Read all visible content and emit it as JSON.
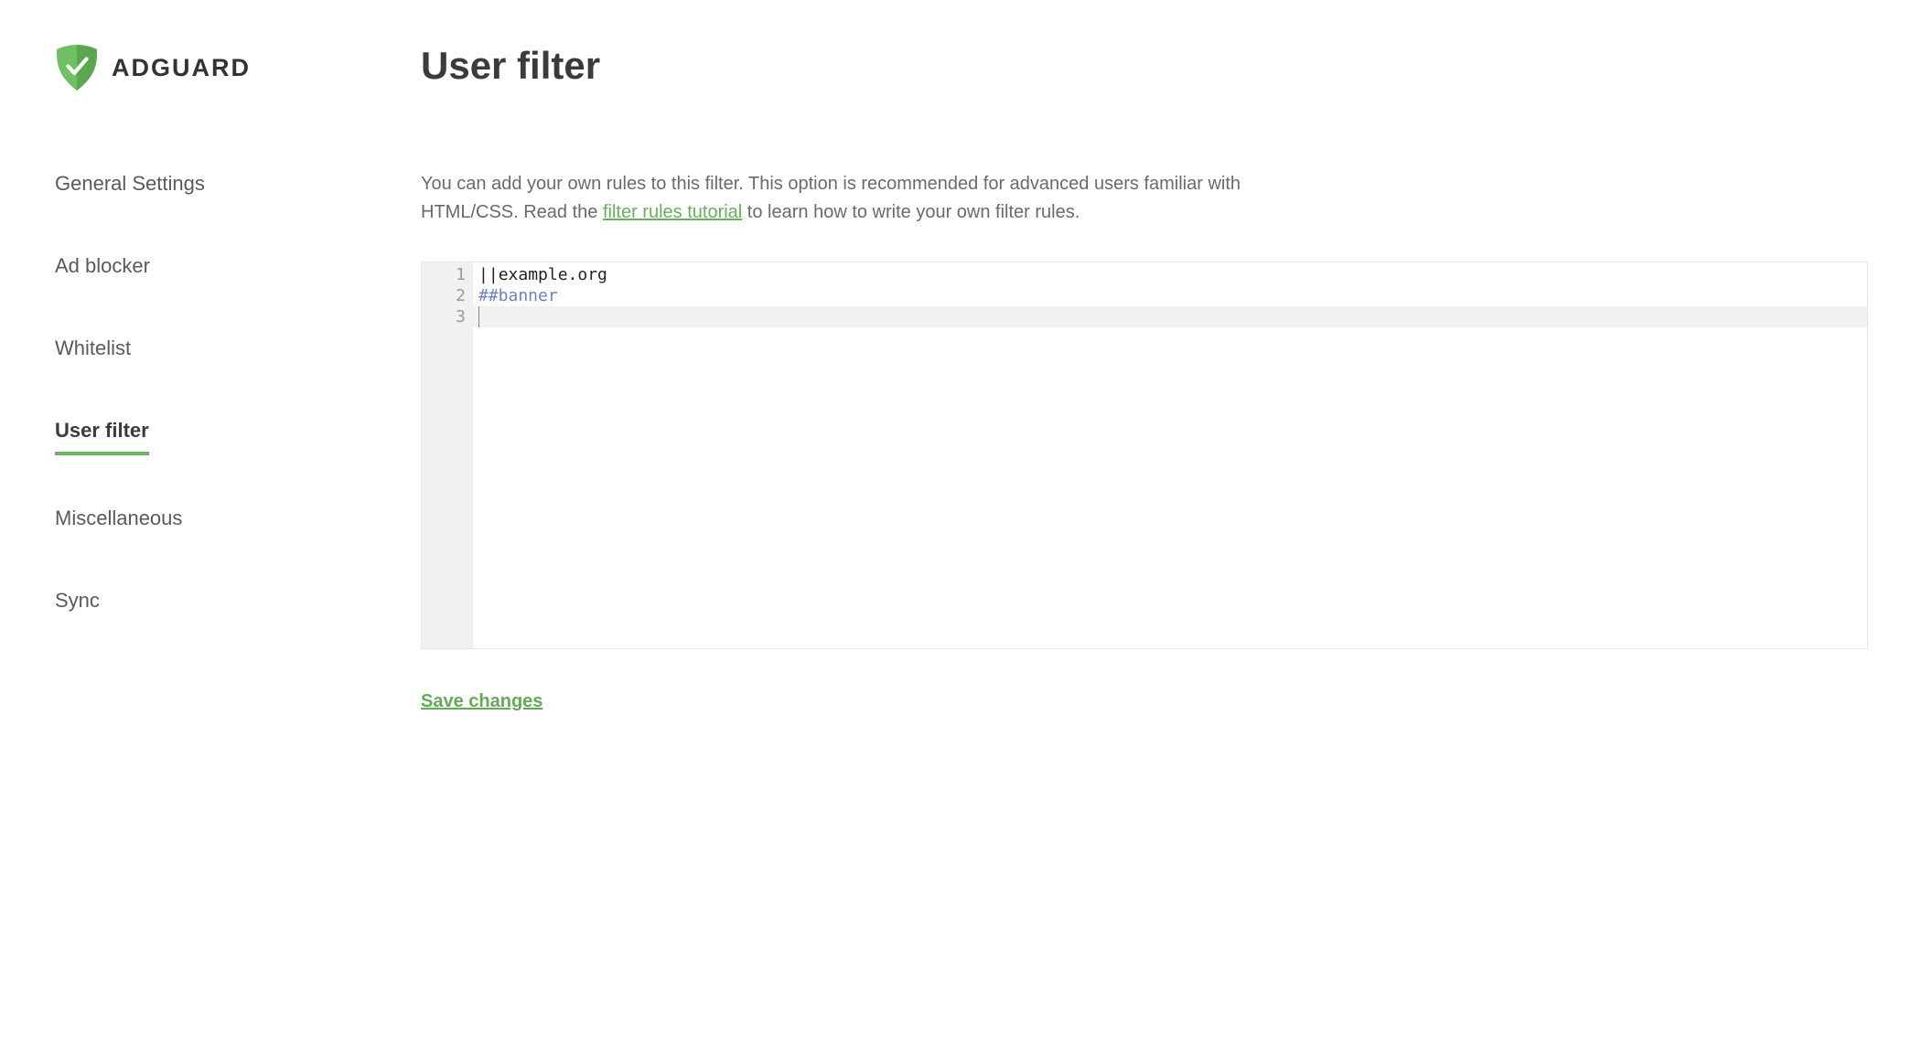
{
  "logo": {
    "text": "ADGUARD"
  },
  "sidebar": {
    "items": [
      {
        "label": "General Settings",
        "active": false
      },
      {
        "label": "Ad blocker",
        "active": false
      },
      {
        "label": "Whitelist",
        "active": false
      },
      {
        "label": "User filter",
        "active": true
      },
      {
        "label": "Miscellaneous",
        "active": false
      },
      {
        "label": "Sync",
        "active": false
      }
    ]
  },
  "main": {
    "title": "User filter",
    "desc_before": "You can add your own rules to this filter. This option is recommended for advanced users familiar with HTML/CSS. Read the ",
    "desc_link": "filter rules tutorial",
    "desc_after": " to learn how to write your own filter rules.",
    "line_numbers": [
      "1",
      "2",
      "3"
    ],
    "line1_op": "||",
    "line1_domain": "example.org",
    "line2_hash": "##banner",
    "save_label": "Save changes"
  }
}
